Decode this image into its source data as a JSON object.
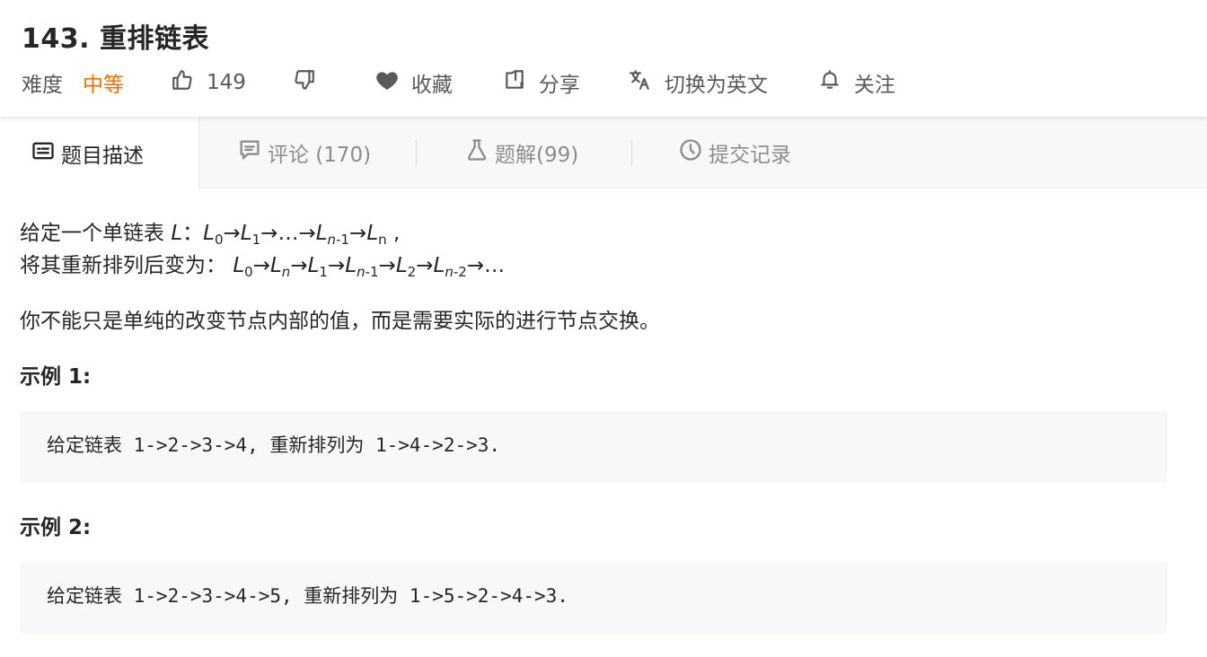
{
  "problem": {
    "title": "143. 重排链表",
    "difficulty_label": "难度",
    "difficulty_value": "中等",
    "likes": "149",
    "favorite_label": "收藏",
    "share_label": "分享",
    "switch_lang_label": "切换为英文",
    "follow_label": "关注"
  },
  "tabs": [
    {
      "label": "题目描述",
      "icon": "description-icon"
    },
    {
      "label": "评论 (170)",
      "icon": "comment-icon"
    },
    {
      "label": "题解(99)",
      "icon": "flask-icon"
    },
    {
      "label": "提交记录",
      "icon": "clock-icon"
    }
  ],
  "description": {
    "line1_prefix": "给定一个单链表 ",
    "line2_prefix": "将其重新排列后变为：",
    "paragraph": "你不能只是单纯的改变节点内部的值，而是需要实际的进行节点交换。",
    "example1_heading": "示例 1:",
    "example1_code": "给定链表 1->2->3->4, 重新排列为 1->4->2->3.",
    "example2_heading": "示例 2:",
    "example2_code": "给定链表 1->2->3->4->5, 重新排列为 1->5->2->4->3."
  },
  "colors": {
    "difficulty_medium": "#ef6c00",
    "text_primary": "#262626",
    "text_secondary": "#595959",
    "tab_bg": "#f7f8fa"
  }
}
